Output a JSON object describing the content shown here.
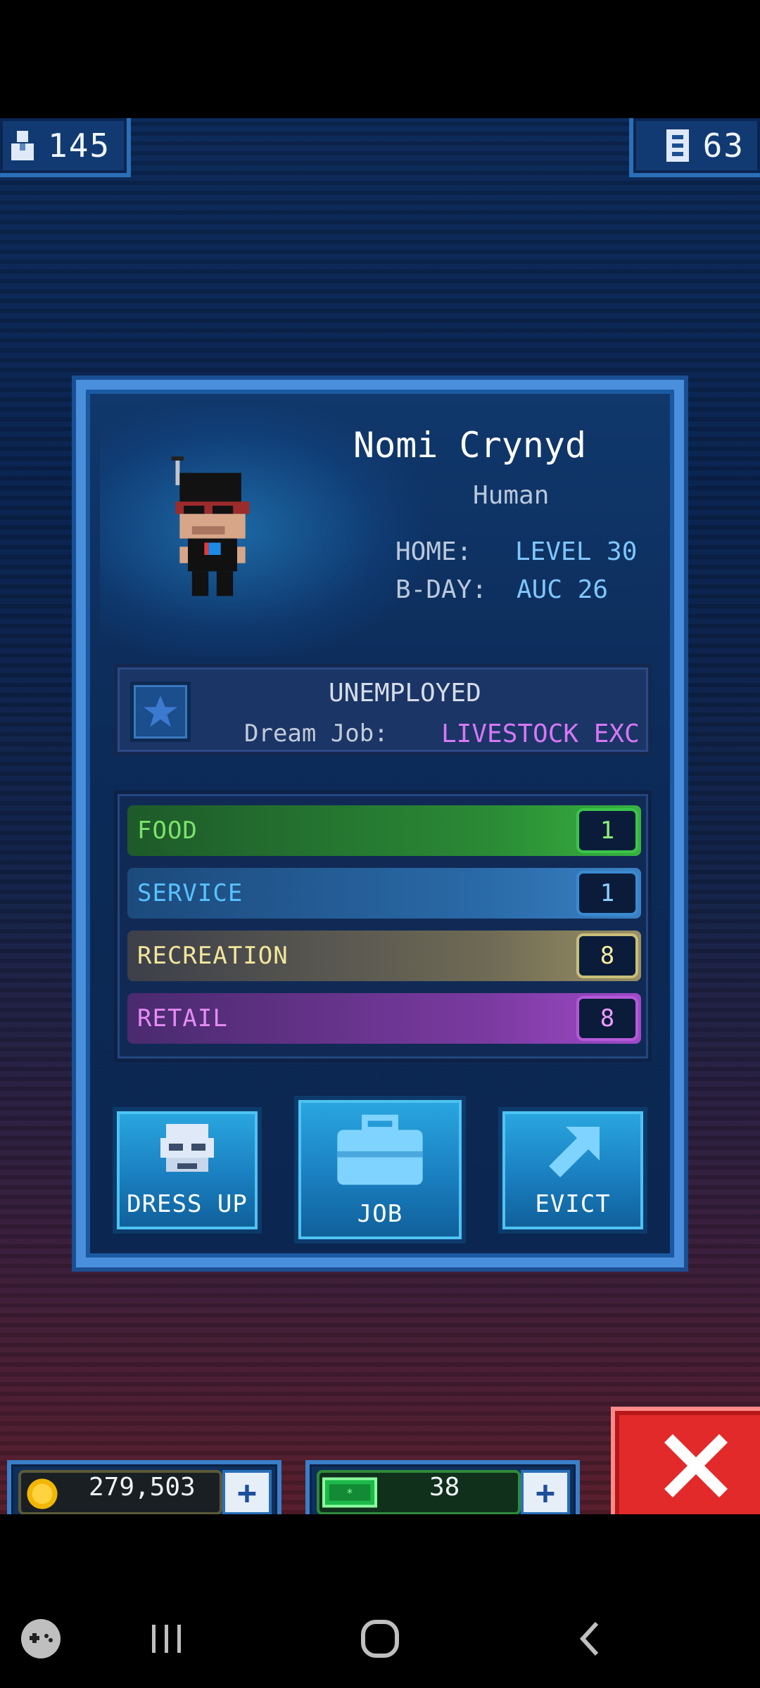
{
  "status_bar": {},
  "hud": {
    "population": "145",
    "floors": "63"
  },
  "card": {
    "name": "Nomi Crynyd",
    "race": "Human",
    "home_label": "HOME:",
    "home_value": "LEVEL 30",
    "bday_label": "B-DAY:",
    "bday_value": "AUC 26",
    "job_status": "UNEMPLOYED",
    "dream_job_label": "Dream Job:",
    "dream_job_value": "LIVESTOCK EXC",
    "skills": [
      {
        "name": "FOOD",
        "value": "1",
        "color": "#37b240"
      },
      {
        "name": "SERVICE",
        "value": "1",
        "color": "#3a82c4"
      },
      {
        "name": "RECREATION",
        "value": "8",
        "color": "#c9be7a"
      },
      {
        "name": "RETAIL",
        "value": "8",
        "color": "#b35ad8"
      }
    ],
    "buttons": {
      "dress_up": "DRESS UP",
      "job": "JOB",
      "evict": "EVICT"
    }
  },
  "currency": {
    "coins": "279,503",
    "bux": "38",
    "plus": "+"
  },
  "icons": {
    "population": "person-icon",
    "floors": "building-icon",
    "coin": "coin-icon",
    "bux": "bux-icon",
    "close": "close-icon",
    "star": "star-icon"
  },
  "colors": {
    "accent": "#4a8fdc",
    "close": "#e22a2a"
  }
}
